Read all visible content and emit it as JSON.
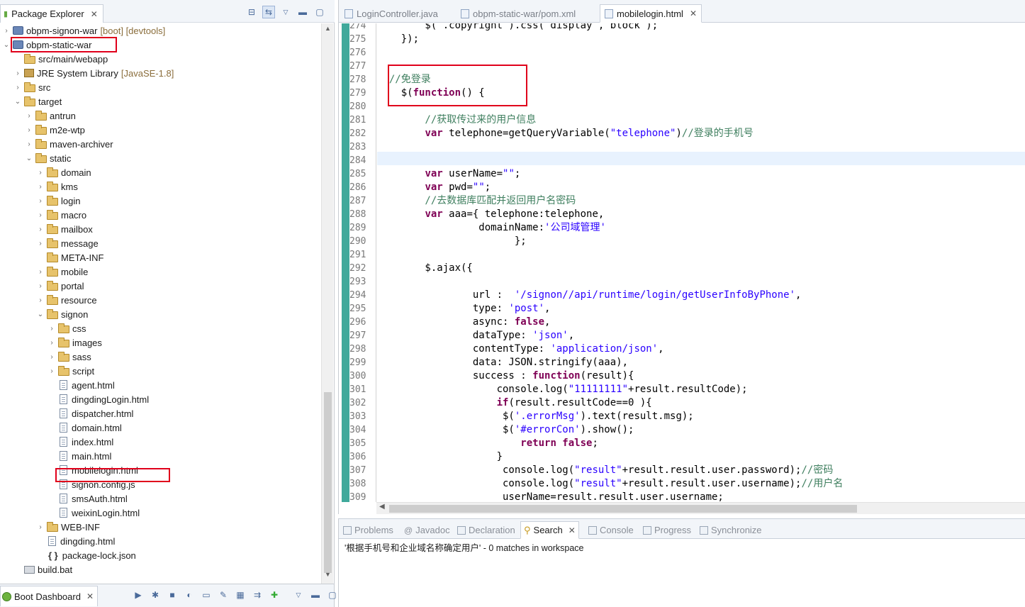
{
  "package_explorer": {
    "tab_title": "Package Explorer",
    "tree": [
      {
        "label": "obpm-signon-war",
        "decoration": "[boot] [devtools]",
        "depth": 0,
        "twisty": "›",
        "icon": "project-icon"
      },
      {
        "label": "obpm-static-war",
        "decoration": "",
        "depth": 0,
        "twisty": "⌄",
        "icon": "project-icon"
      },
      {
        "label": "src/main/webapp",
        "decoration": "",
        "depth": 1,
        "twisty": "",
        "icon": "folder-icon"
      },
      {
        "label": "JRE System Library",
        "decoration": "[JavaSE-1.8]",
        "depth": 1,
        "twisty": "›",
        "icon": "library-icon"
      },
      {
        "label": "src",
        "decoration": "",
        "depth": 1,
        "twisty": "›",
        "icon": "folder-icon"
      },
      {
        "label": "target",
        "decoration": "",
        "depth": 1,
        "twisty": "⌄",
        "icon": "folder-icon"
      },
      {
        "label": "antrun",
        "decoration": "",
        "depth": 2,
        "twisty": "›",
        "icon": "folder-icon"
      },
      {
        "label": "m2e-wtp",
        "decoration": "",
        "depth": 2,
        "twisty": "›",
        "icon": "folder-icon"
      },
      {
        "label": "maven-archiver",
        "decoration": "",
        "depth": 2,
        "twisty": "›",
        "icon": "folder-icon"
      },
      {
        "label": "static",
        "decoration": "",
        "depth": 2,
        "twisty": "⌄",
        "icon": "folder-icon"
      },
      {
        "label": "domain",
        "decoration": "",
        "depth": 3,
        "twisty": "›",
        "icon": "folder-icon"
      },
      {
        "label": "kms",
        "decoration": "",
        "depth": 3,
        "twisty": "›",
        "icon": "folder-icon"
      },
      {
        "label": "login",
        "decoration": "",
        "depth": 3,
        "twisty": "›",
        "icon": "folder-icon"
      },
      {
        "label": "macro",
        "decoration": "",
        "depth": 3,
        "twisty": "›",
        "icon": "folder-icon"
      },
      {
        "label": "mailbox",
        "decoration": "",
        "depth": 3,
        "twisty": "›",
        "icon": "folder-icon"
      },
      {
        "label": "message",
        "decoration": "",
        "depth": 3,
        "twisty": "›",
        "icon": "folder-icon"
      },
      {
        "label": "META-INF",
        "decoration": "",
        "depth": 3,
        "twisty": "",
        "icon": "folder-icon"
      },
      {
        "label": "mobile",
        "decoration": "",
        "depth": 3,
        "twisty": "›",
        "icon": "folder-icon"
      },
      {
        "label": "portal",
        "decoration": "",
        "depth": 3,
        "twisty": "›",
        "icon": "folder-icon"
      },
      {
        "label": "resource",
        "decoration": "",
        "depth": 3,
        "twisty": "›",
        "icon": "folder-icon"
      },
      {
        "label": "signon",
        "decoration": "",
        "depth": 3,
        "twisty": "⌄",
        "icon": "folder-icon"
      },
      {
        "label": "css",
        "decoration": "",
        "depth": 4,
        "twisty": "›",
        "icon": "folder-icon"
      },
      {
        "label": "images",
        "decoration": "",
        "depth": 4,
        "twisty": "›",
        "icon": "folder-icon"
      },
      {
        "label": "sass",
        "decoration": "",
        "depth": 4,
        "twisty": "›",
        "icon": "folder-icon"
      },
      {
        "label": "script",
        "decoration": "",
        "depth": 4,
        "twisty": "›",
        "icon": "folder-icon"
      },
      {
        "label": "agent.html",
        "decoration": "",
        "depth": 4,
        "twisty": "",
        "icon": "html-file-icon"
      },
      {
        "label": "dingdingLogin.html",
        "decoration": "",
        "depth": 4,
        "twisty": "",
        "icon": "html-file-icon"
      },
      {
        "label": "dispatcher.html",
        "decoration": "",
        "depth": 4,
        "twisty": "",
        "icon": "html-file-icon"
      },
      {
        "label": "domain.html",
        "decoration": "",
        "depth": 4,
        "twisty": "",
        "icon": "html-file-icon"
      },
      {
        "label": "index.html",
        "decoration": "",
        "depth": 4,
        "twisty": "",
        "icon": "html-file-icon"
      },
      {
        "label": "main.html",
        "decoration": "",
        "depth": 4,
        "twisty": "",
        "icon": "html-file-icon"
      },
      {
        "label": "mobilelogin.html",
        "decoration": "",
        "depth": 4,
        "twisty": "",
        "icon": "html-file-icon"
      },
      {
        "label": "signon.config.js",
        "decoration": "",
        "depth": 4,
        "twisty": "",
        "icon": "js-file-icon"
      },
      {
        "label": "smsAuth.html",
        "decoration": "",
        "depth": 4,
        "twisty": "",
        "icon": "html-file-icon"
      },
      {
        "label": "weixinLogin.html",
        "decoration": "",
        "depth": 4,
        "twisty": "",
        "icon": "html-file-icon"
      },
      {
        "label": "WEB-INF",
        "decoration": "",
        "depth": 3,
        "twisty": "›",
        "icon": "folder-icon"
      },
      {
        "label": "dingding.html",
        "decoration": "",
        "depth": 3,
        "twisty": "",
        "icon": "html-file-icon"
      },
      {
        "label": "package-lock.json",
        "decoration": "",
        "depth": 3,
        "twisty": "",
        "icon": "json-file-icon"
      },
      {
        "label": "build.bat",
        "decoration": "",
        "depth": 1,
        "twisty": "",
        "icon": "bat-file-icon"
      }
    ]
  },
  "boot_dashboard": {
    "tab_title": "Boot Dashboard"
  },
  "editor": {
    "tabs": [
      {
        "label": "LoginController.java",
        "active": false
      },
      {
        "label": "obpm-static-war/pom.xml",
        "active": false
      },
      {
        "label": "mobilelogin.html",
        "active": true
      }
    ],
    "current_line": 284,
    "lines": [
      {
        "n": 274,
        "segs": [
          [
            "",
            "        $( .copyright ).css( display , block );"
          ]
        ]
      },
      {
        "n": 275,
        "segs": [
          [
            "",
            "    });"
          ]
        ]
      },
      {
        "n": 276,
        "segs": [
          [
            "",
            ""
          ]
        ]
      },
      {
        "n": 277,
        "segs": [
          [
            "",
            ""
          ]
        ]
      },
      {
        "n": 278,
        "segs": [
          [
            "cm",
            "  //免登录"
          ]
        ]
      },
      {
        "n": 279,
        "segs": [
          [
            "",
            "    $("
          ],
          [
            "kw",
            "function"
          ],
          [
            "",
            "() {"
          ]
        ]
      },
      {
        "n": 280,
        "segs": [
          [
            "",
            ""
          ]
        ]
      },
      {
        "n": 281,
        "segs": [
          [
            "cm",
            "        //获取传过来的用户信息"
          ]
        ]
      },
      {
        "n": 282,
        "segs": [
          [
            "",
            "        "
          ],
          [
            "kw",
            "var"
          ],
          [
            "",
            " telephone=getQueryVariable("
          ],
          [
            "str",
            "\"telephone\""
          ],
          [
            "",
            ")"
          ],
          [
            "cm",
            "//登录的手机号"
          ]
        ]
      },
      {
        "n": 283,
        "segs": [
          [
            "",
            ""
          ]
        ]
      },
      {
        "n": 284,
        "segs": [
          [
            "",
            ""
          ]
        ]
      },
      {
        "n": 285,
        "segs": [
          [
            "",
            "        "
          ],
          [
            "kw",
            "var"
          ],
          [
            "",
            " userName="
          ],
          [
            "str",
            "\"\""
          ],
          [
            "",
            ";"
          ]
        ]
      },
      {
        "n": 286,
        "segs": [
          [
            "",
            "        "
          ],
          [
            "kw",
            "var"
          ],
          [
            "",
            " pwd="
          ],
          [
            "str",
            "\"\""
          ],
          [
            "",
            ";"
          ]
        ]
      },
      {
        "n": 287,
        "segs": [
          [
            "cm",
            "        //去数据库匹配并返回用户名密码"
          ]
        ]
      },
      {
        "n": 288,
        "segs": [
          [
            "",
            "        "
          ],
          [
            "kw",
            "var"
          ],
          [
            "",
            " aaa={ telephone:telephone,"
          ]
        ]
      },
      {
        "n": 289,
        "segs": [
          [
            "",
            "                 domainName:"
          ],
          [
            "str",
            "'公司域管理'"
          ]
        ]
      },
      {
        "n": 290,
        "segs": [
          [
            "",
            "                       };"
          ]
        ]
      },
      {
        "n": 291,
        "segs": [
          [
            "",
            ""
          ]
        ]
      },
      {
        "n": 292,
        "segs": [
          [
            "",
            "        $.ajax({"
          ]
        ]
      },
      {
        "n": 293,
        "segs": [
          [
            "",
            ""
          ]
        ]
      },
      {
        "n": 294,
        "segs": [
          [
            "",
            "                url :  "
          ],
          [
            "str",
            "'/signon//api/runtime/login/getUserInfoByPhone'"
          ],
          [
            "",
            ","
          ]
        ]
      },
      {
        "n": 295,
        "segs": [
          [
            "",
            "                type: "
          ],
          [
            "str",
            "'post'"
          ],
          [
            "",
            ","
          ]
        ]
      },
      {
        "n": 296,
        "segs": [
          [
            "",
            "                async: "
          ],
          [
            "kw",
            "false"
          ],
          [
            "",
            ","
          ]
        ]
      },
      {
        "n": 297,
        "segs": [
          [
            "",
            "                dataType: "
          ],
          [
            "str",
            "'json'"
          ],
          [
            "",
            ","
          ]
        ]
      },
      {
        "n": 298,
        "segs": [
          [
            "",
            "                contentType: "
          ],
          [
            "str",
            "'application/json'"
          ],
          [
            "",
            ","
          ]
        ]
      },
      {
        "n": 299,
        "segs": [
          [
            "",
            "                data: JSON.stringify(aaa),"
          ]
        ]
      },
      {
        "n": 300,
        "segs": [
          [
            "",
            "                success : "
          ],
          [
            "kw",
            "function"
          ],
          [
            "",
            "(result){"
          ]
        ]
      },
      {
        "n": 301,
        "segs": [
          [
            "",
            "                    console.log("
          ],
          [
            "str",
            "\"11111111\""
          ],
          [
            "",
            "+result.resultCode);"
          ]
        ]
      },
      {
        "n": 302,
        "segs": [
          [
            "",
            "                    "
          ],
          [
            "kw",
            "if"
          ],
          [
            "",
            "(result.resultCode==0 ){"
          ]
        ]
      },
      {
        "n": 303,
        "segs": [
          [
            "",
            "                     $("
          ],
          [
            "str",
            "'.errorMsg'"
          ],
          [
            "",
            ").text(result.msg);"
          ]
        ]
      },
      {
        "n": 304,
        "segs": [
          [
            "",
            "                     $("
          ],
          [
            "str",
            "'#errorCon'"
          ],
          [
            "",
            ").show();"
          ]
        ]
      },
      {
        "n": 305,
        "segs": [
          [
            "",
            "                        "
          ],
          [
            "kw",
            "return false"
          ],
          [
            "",
            ";"
          ]
        ]
      },
      {
        "n": 306,
        "segs": [
          [
            "",
            "                    }"
          ]
        ]
      },
      {
        "n": 307,
        "segs": [
          [
            "",
            "                     console.log("
          ],
          [
            "str",
            "\"result\""
          ],
          [
            "",
            "+result.result.user.password);"
          ],
          [
            "cm",
            "//密码"
          ]
        ]
      },
      {
        "n": 308,
        "segs": [
          [
            "",
            "                     console.log("
          ],
          [
            "str",
            "\"result\""
          ],
          [
            "",
            "+result.result.user.username);"
          ],
          [
            "cm",
            "//用户名"
          ]
        ]
      },
      {
        "n": 309,
        "segs": [
          [
            "",
            "                     userName=result.result.user.username;"
          ]
        ]
      }
    ]
  },
  "bottom_views": {
    "tabs": [
      {
        "label": "Problems",
        "active": false
      },
      {
        "label": "Javadoc",
        "active": false
      },
      {
        "label": "Declaration",
        "active": false
      },
      {
        "label": "Search",
        "active": true
      },
      {
        "label": "Console",
        "active": false
      },
      {
        "label": "Progress",
        "active": false
      },
      {
        "label": "Synchronize",
        "active": false
      }
    ],
    "search_result": "'根据手机号和企业域名称确定用户' - 0 matches in workspace"
  },
  "colors": {
    "highlight_box": "#e0001b",
    "keyword": "#7f0055",
    "string": "#2a00ff",
    "comment": "#3f7f5f",
    "current_line": "#e8f2fe"
  }
}
